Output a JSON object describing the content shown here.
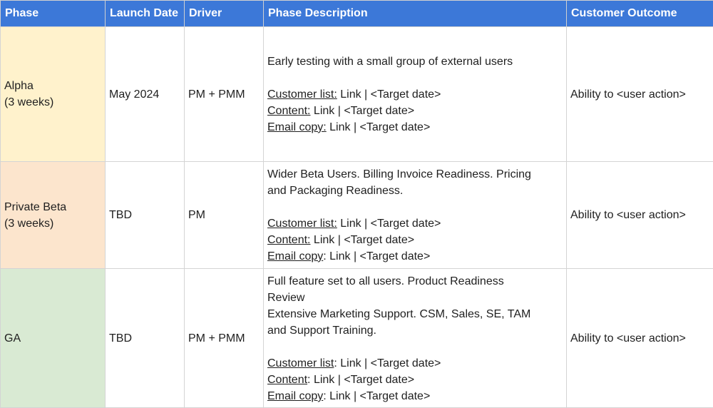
{
  "table": {
    "headers": {
      "phase": "Phase",
      "launch_date": "Launch Date",
      "driver": "Driver",
      "description": "Phase Description",
      "outcome": "Customer Outcome"
    },
    "rows": [
      {
        "phase_name": "Alpha",
        "phase_duration": "(3 weeks)",
        "launch_date": "May 2024",
        "driver": "PM + PMM",
        "description_lines": [
          "Early testing with a small group of external users"
        ],
        "links": [
          {
            "label": "Customer list:",
            "value": " Link | <Target date>"
          },
          {
            "label": "Content:",
            "value": " Link | <Target date>"
          },
          {
            "label": "Email copy:",
            "value": " Link | <Target date>"
          }
        ],
        "outcome": "Ability to <user action>"
      },
      {
        "phase_name": "Private Beta",
        "phase_duration": "(3 weeks)",
        "launch_date": "TBD",
        "driver": "PM",
        "description_lines": [
          "Wider Beta Users. Billing Invoice Readiness. Pricing",
          "and Packaging Readiness."
        ],
        "links": [
          {
            "label": "Customer list:",
            "value": " Link | <Target date>"
          },
          {
            "label": "Content:",
            "value": " Link | <Target date>"
          },
          {
            "label": "Email copy",
            "value": ": Link | <Target date>"
          }
        ],
        "outcome": "Ability to <user action>"
      },
      {
        "phase_name": "GA",
        "phase_duration": "",
        "launch_date": "TBD",
        "driver": "PM + PMM",
        "description_lines": [
          "Full feature set to all users. Product Readiness",
          "Review",
          "Extensive Marketing Support. CSM, Sales, SE, TAM",
          "and Support Training."
        ],
        "links": [
          {
            "label": "Customer list",
            "value": ": Link | <Target date>"
          },
          {
            "label": "Content",
            "value": ": Link | <Target date>"
          },
          {
            "label": "Email copy",
            "value": ": Link | <Target date>"
          }
        ],
        "outcome": "Ability to <user action>"
      }
    ]
  }
}
